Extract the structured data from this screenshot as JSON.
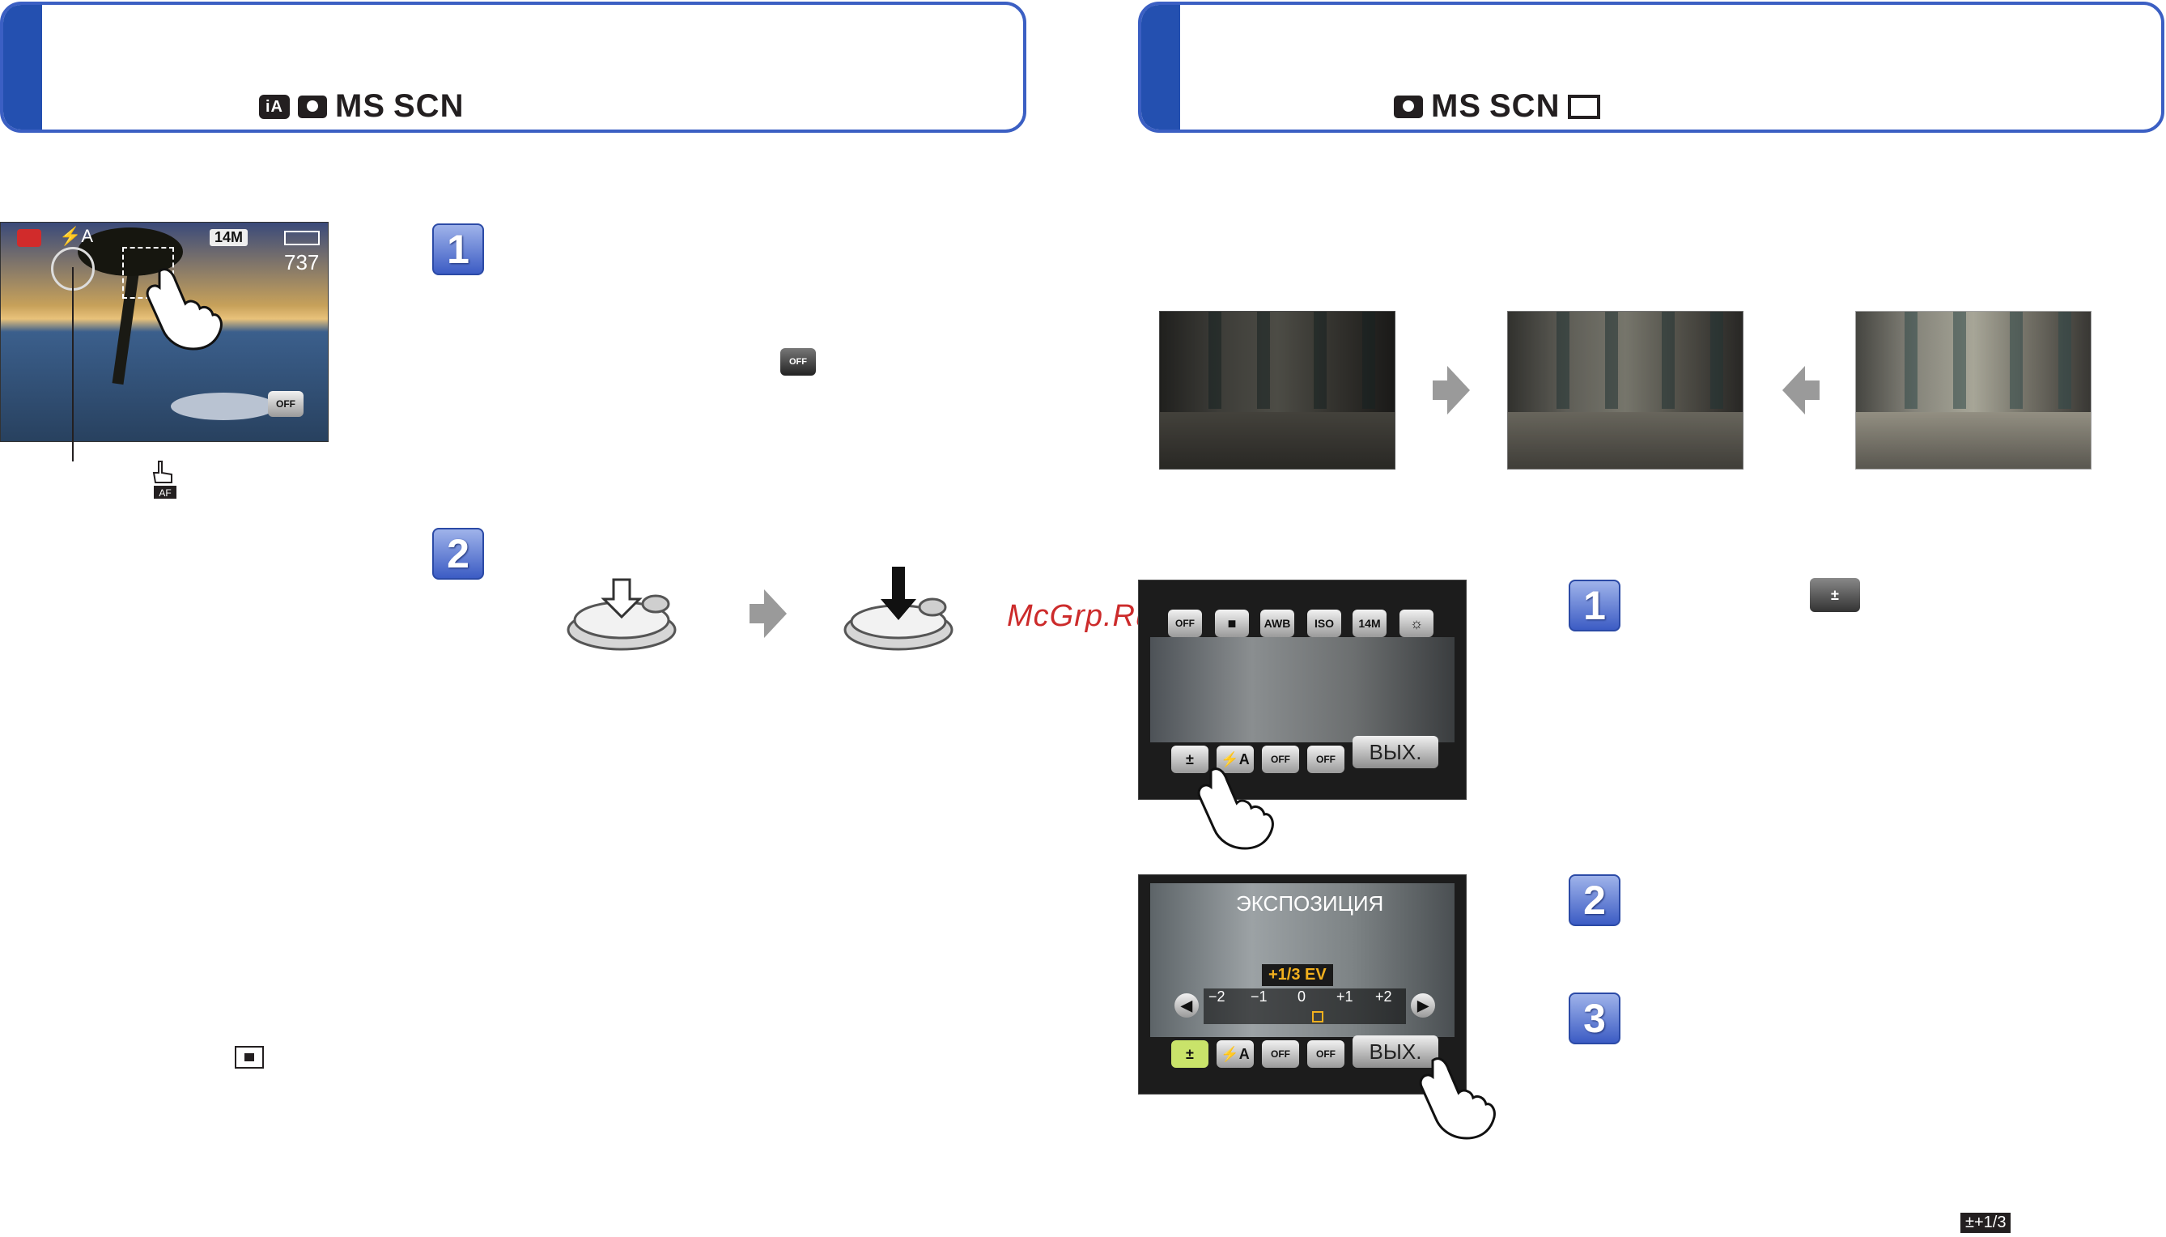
{
  "left_header": {
    "modes": [
      "iA",
      "camera",
      "MS",
      "SCN"
    ],
    "ms": "MS",
    "scn": "SCN",
    "ia": "iA"
  },
  "right_header": {
    "modes": [
      "camera",
      "MS",
      "SCN",
      "movie"
    ],
    "ms": "MS",
    "scn": "SCN"
  },
  "lcd": {
    "flash": "⚡A",
    "res": "14M",
    "count": "737"
  },
  "steps": {
    "one": "1",
    "two": "2",
    "three": "3"
  },
  "screen1": {
    "top_icons": [
      "OFF",
      "■",
      "AWB",
      "ISO",
      "14M",
      "☼"
    ],
    "bottom_icons": [
      "±",
      "⚡A",
      "OFF",
      "OFF"
    ],
    "exit": "ВЫХ."
  },
  "screen2": {
    "title": "ЭКСПОЗИЦИЯ",
    "ev": "+1/3 EV",
    "scale": [
      "−2",
      "−1",
      "0",
      "+1",
      "+2"
    ],
    "bottom_icons": [
      "±",
      "⚡A",
      "OFF",
      "OFF"
    ],
    "exit": "ВЫХ."
  },
  "watermark": "McGrp.Ru",
  "footer_icon": "±+1/3",
  "colors": {
    "accent": "#3b5fc3",
    "tab": "#2450b0",
    "watermark": "#cc2b2b"
  }
}
